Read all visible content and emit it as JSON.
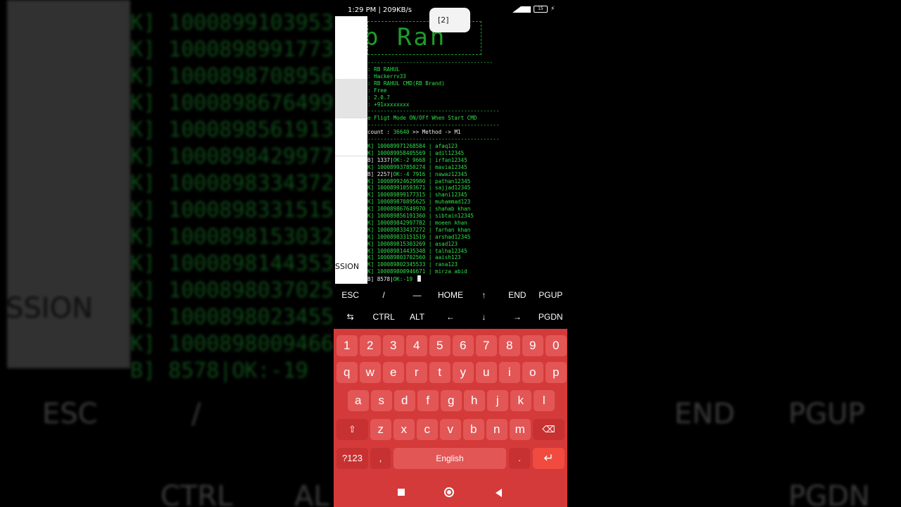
{
  "status_bar": {
    "time_speed": "1:29 PM | 209KB/s",
    "battery": "15"
  },
  "banner_text": "b Rah",
  "toast": "[2]",
  "info": [
    ": RB RAHUL",
    ": Hackerrv33",
    ": RB RAHUL CMD(RB Brand)",
    ": Free",
    ": 2.0.7",
    ": +91xxxxxxxx"
  ],
  "notice": "e Fligt Mode ON/OFf When Start CMD",
  "count_line": {
    "prefix": "count : ",
    "count": "36640",
    "suffix": " >> Method -> M1"
  },
  "results": [
    {
      "tag": "K]",
      "id": "100089971268584",
      "pass": "afaq123"
    },
    {
      "tag": "K]",
      "id": "100089958405569",
      "pass": "adil12345"
    },
    {
      "tag": "B]",
      "id": "1337",
      "status": "OK:-2 9668",
      "pass": "irfan12345"
    },
    {
      "tag": "K]",
      "id": "100089937850274",
      "pass": "mavia12345"
    },
    {
      "tag": "B]",
      "id": "2257",
      "status": "OK:-4 7916",
      "pass": "nawaz12345"
    },
    {
      "tag": "K]",
      "id": "100089924629900",
      "pass": "pathan12345"
    },
    {
      "tag": "K]",
      "id": "100089910593671",
      "pass": "sajjad12345"
    },
    {
      "tag": "K]",
      "id": "100089899177315",
      "pass": "shani12345"
    },
    {
      "tag": "K]",
      "id": "100089870895625",
      "pass": "muhammad123"
    },
    {
      "tag": "K]",
      "id": "100089867649970",
      "pass": "shahab khan"
    },
    {
      "tag": "K]",
      "id": "100089856191360",
      "pass": "sibtain12345"
    },
    {
      "tag": "K]",
      "id": "100089842997782",
      "pass": "moeen khan"
    },
    {
      "tag": "K]",
      "id": "100089833437272",
      "pass": "farhan khan"
    },
    {
      "tag": "K]",
      "id": "100089833151519",
      "pass": "arshad12345"
    },
    {
      "tag": "K]",
      "id": "100089815303269",
      "pass": "asad123"
    },
    {
      "tag": "K]",
      "id": "100089814435348",
      "pass": "talha12345"
    },
    {
      "tag": "K]",
      "id": "100089803702560",
      "pass": "aaish123"
    },
    {
      "tag": "K]",
      "id": "100089802345533",
      "pass": "rana123"
    },
    {
      "tag": "K]",
      "id": "100089800946671",
      "pass": "mirza abid"
    }
  ],
  "last_line": {
    "tag": "B]",
    "id": "8578",
    "status": "OK:-19"
  },
  "drawer_label": "SSION",
  "extra_keys_row1": [
    "ESC",
    "/",
    "—",
    "HOME",
    "↑",
    "END",
    "PGUP"
  ],
  "extra_keys_row2": [
    "⇆",
    "CTRL",
    "ALT",
    "←",
    "↓",
    "→",
    "PGDN"
  ],
  "keyboard": {
    "numbers": [
      "1",
      "2",
      "3",
      "4",
      "5",
      "6",
      "7",
      "8",
      "9",
      "0"
    ],
    "row1": [
      "q",
      "w",
      "e",
      "r",
      "t",
      "y",
      "u",
      "i",
      "o",
      "p"
    ],
    "row2": [
      "a",
      "s",
      "d",
      "f",
      "g",
      "h",
      "j",
      "k",
      "l"
    ],
    "row3": [
      "z",
      "x",
      "c",
      "v",
      "b",
      "n",
      "m"
    ],
    "sym_label": "?123",
    "comma": ",",
    "space_label": "English",
    "period": "."
  },
  "background": {
    "lines": [
      "K] 1000899103953",
      "K] 1000898991773",
      "K] 1000898708956",
      "K] 1000898676499",
      "K] 1000898561913",
      "K] 1000898429977",
      "K] 1000898334372",
      "K] 1000898331515",
      "K] 1000898153032",
      "K] 1000898144353",
      "K] 1000898037025",
      "K] 1000898023455",
      "K] 1000898009466",
      "B] 8578|OK:-19"
    ],
    "session": "SSION",
    "keys": [
      "ESC",
      "/",
      "END",
      "PGUP",
      "CTRL",
      "AL",
      "PGDN"
    ]
  },
  "colors": {
    "terminal_green": "#2fe04a",
    "keyboard_red": "#d43a3a"
  }
}
